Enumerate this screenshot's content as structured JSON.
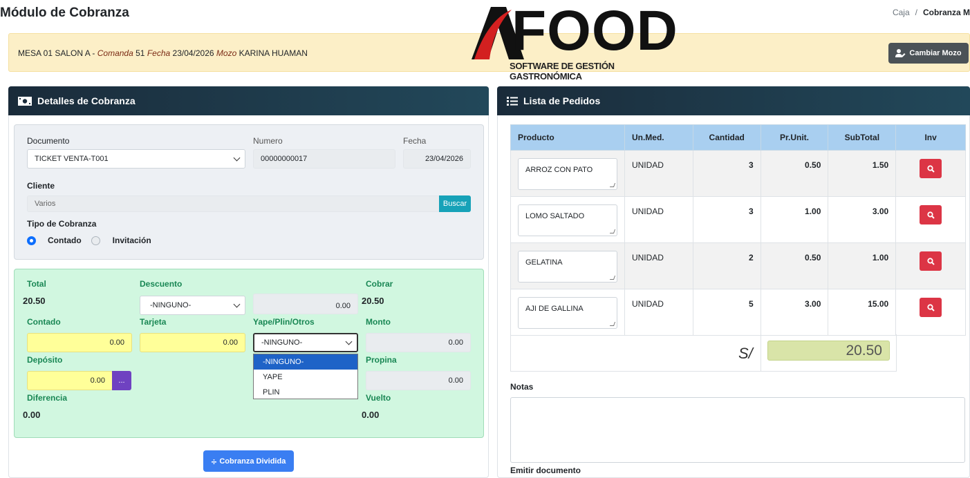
{
  "page": {
    "title": "Módulo de Cobranza",
    "breadcrumb": [
      "Caja",
      "Cobranza M"
    ]
  },
  "logo": {
    "brand": "FOOD",
    "subtitle": "SOFTWARE DE GESTIÓN GASTRONÓMICA"
  },
  "mesa": {
    "prefix": "MESA 01 SALON A - ",
    "comanda_label": "Comanda",
    "comanda": "51",
    "fecha_label": "Fecha",
    "fecha": "23/04/2026",
    "mozo_label": "Mozo",
    "mozo": "KARINA HUAMAN"
  },
  "cambiar_mozo": "Cambiar Mozo",
  "detalles": {
    "title": "Detalles de Cobranza",
    "documento_label": "Documento",
    "documento": "TICKET VENTA-T001",
    "numero_label": "Numero",
    "numero": "00000000017",
    "fecha_label": "Fecha",
    "fecha": "23/04/2026",
    "cliente_label": "Cliente",
    "cliente": "Varios",
    "buscar": "Buscar",
    "tipo_label": "Tipo de Cobranza",
    "contado": "Contado",
    "invitacion": "Invitación"
  },
  "pago": {
    "total_label": "Total",
    "total": "20.50",
    "descuento_label": "Descuento",
    "descuento": "-NINGUNO-",
    "descuento_monto": "0.00",
    "cobrar_label": "Cobrar",
    "cobrar": "20.50",
    "contado_label": "Contado",
    "contado": "0.00",
    "tarjeta_label": "Tarjeta",
    "tarjeta": "0.00",
    "yape_label": "Yape/Plin/Otros",
    "yape": "-NINGUNO-",
    "monto_label": "Monto",
    "monto": "0.00",
    "deposito_label": "Depósito",
    "deposito": "0.00",
    "deposito_btn": "...",
    "propina_label": "Propina",
    "propina": "0.00",
    "diferencia_label": "Diferencia",
    "diferencia": "0.00",
    "vuelto_label": "Vuelto",
    "vuelto": "0.00",
    "dropdown_options": [
      "-NINGUNO-",
      "YAPE",
      "PLIN"
    ]
  },
  "cobranza_dividida": "Cobranza Dividida",
  "pedidos": {
    "title": "Lista de Pedidos",
    "headers": [
      "Producto",
      "Un.Med.",
      "Cantidad",
      "Pr.Unit.",
      "SubTotal",
      "Inv"
    ],
    "rows": [
      {
        "producto": "ARROZ CON PATO",
        "unidad": "UNIDAD",
        "cantidad": "3",
        "precio": "0.50",
        "subtotal": "1.50"
      },
      {
        "producto": "LOMO SALTADO",
        "unidad": "UNIDAD",
        "cantidad": "3",
        "precio": "1.00",
        "subtotal": "3.00"
      },
      {
        "producto": "GELATINA",
        "unidad": "UNIDAD",
        "cantidad": "2",
        "precio": "0.50",
        "subtotal": "1.00"
      },
      {
        "producto": "AJI DE GALLINA",
        "unidad": "UNIDAD",
        "cantidad": "5",
        "precio": "3.00",
        "subtotal": "15.00"
      }
    ],
    "moneda": "S/",
    "total": "20.50"
  },
  "notas_label": "Notas",
  "emitir_label": "Emitir documento",
  "colors": {
    "header": "#1a2b3a",
    "mesa_bg": "#fcefc7",
    "pago_bg": "#d1f7e0",
    "yellow_input": "#ffff99",
    "danger": "#dc3545",
    "primary": "#3a7ef2"
  }
}
